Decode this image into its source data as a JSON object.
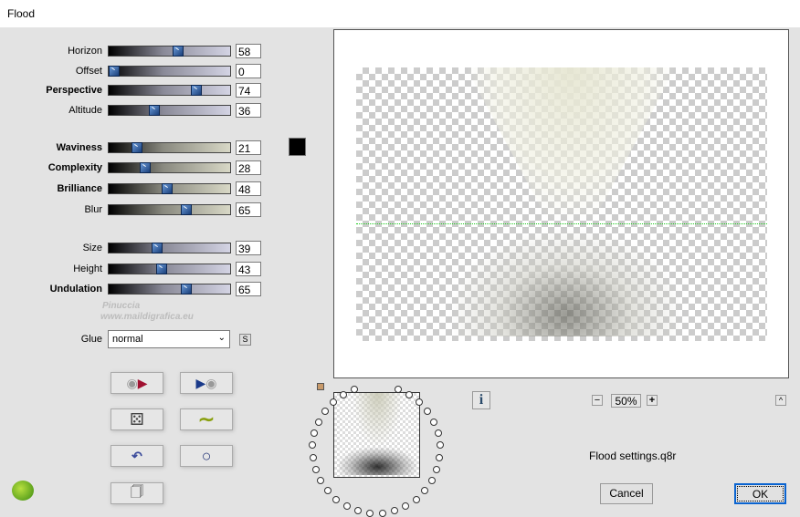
{
  "window": {
    "title": "Flood"
  },
  "sliders": [
    {
      "id": "horizon",
      "label": "Horizon",
      "value": 58,
      "style": "lav",
      "bold": false
    },
    {
      "id": "offset",
      "label": "Offset",
      "value": 0,
      "style": "lav",
      "bold": false
    },
    {
      "id": "perspective",
      "label": "Perspective",
      "value": 74,
      "style": "lav",
      "bold": true
    },
    {
      "id": "altitude",
      "label": "Altitude",
      "value": 36,
      "style": "lav",
      "bold": false
    },
    {
      "id": "waviness",
      "label": "Waviness",
      "value": 21,
      "style": "beige",
      "bold": true
    },
    {
      "id": "complexity",
      "label": "Complexity",
      "value": 28,
      "style": "beige",
      "bold": true
    },
    {
      "id": "brilliance",
      "label": "Brilliance",
      "value": 48,
      "style": "beige",
      "bold": true
    },
    {
      "id": "blur",
      "label": "Blur",
      "value": 65,
      "style": "beige",
      "bold": false
    },
    {
      "id": "size",
      "label": "Size",
      "value": 39,
      "style": "lav",
      "bold": false
    },
    {
      "id": "height",
      "label": "Height",
      "value": 43,
      "style": "lav",
      "bold": false
    },
    {
      "id": "undulation",
      "label": "Undulation",
      "value": 65,
      "style": "lav",
      "bold": true
    }
  ],
  "color_swatch": "#000000",
  "glue": {
    "label": "Glue",
    "value": "normal",
    "s_button": "S"
  },
  "watermark": {
    "line1": "Pinuccia",
    "line2": "www.maildigrafica.eu"
  },
  "zoom": {
    "minus": "−",
    "value": "50%",
    "plus": "+"
  },
  "info_button": "i",
  "collapse_button": "^",
  "settings_file": "Flood settings.q8r",
  "buttons": {
    "cancel": "Cancel",
    "ok": "OK"
  }
}
